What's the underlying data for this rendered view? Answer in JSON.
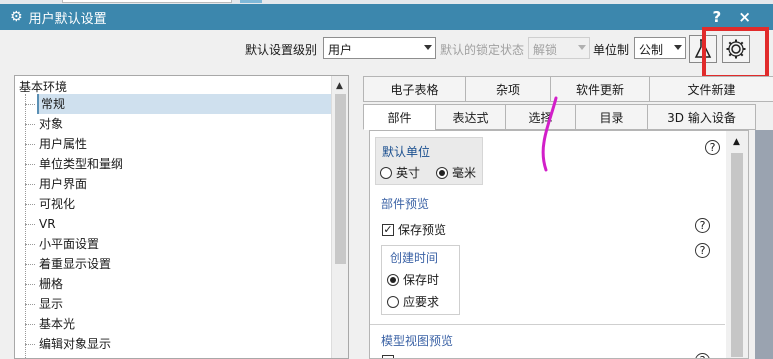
{
  "window": {
    "title": "用户默认设置",
    "controls": "? ×"
  },
  "toolbar": {
    "default_level_label": "默认设置级别",
    "default_level_value": "用户",
    "lock_state_label": "默认的锁定状态",
    "lock_state_value": "解锁",
    "unit_system_label": "单位制",
    "unit_system_value": "公制"
  },
  "tree": {
    "root": "基本环境",
    "items": [
      {
        "label": "常规",
        "selected": true
      },
      {
        "label": "对象"
      },
      {
        "label": "用户属性"
      },
      {
        "label": "单位类型和量纲"
      },
      {
        "label": "用户界面"
      },
      {
        "label": "可视化"
      },
      {
        "label": "VR"
      },
      {
        "label": "小平面设置"
      },
      {
        "label": "着重显示设置"
      },
      {
        "label": "栅格"
      },
      {
        "label": "显示"
      },
      {
        "label": "基本光"
      },
      {
        "label": "编辑对象显示"
      }
    ]
  },
  "tabs": {
    "row1": [
      "电子表格",
      "杂项",
      "软件更新",
      "文件新建"
    ],
    "row2": [
      "部件",
      "表达式",
      "选择",
      "目录",
      "3D 输入设备"
    ],
    "active": "部件"
  },
  "content": {
    "default_unit_title": "默认单位",
    "unit_inch": "英寸",
    "unit_mm": "毫米",
    "selected_unit": "毫米",
    "part_preview_title": "部件预览",
    "save_preview_label": "保存预览",
    "save_preview_checked": true,
    "creation_time_title": "创建时间",
    "on_save_label": "保存时",
    "on_demand_label": "应要求",
    "creation_time_value": "保存时",
    "model_view_preview_title": "模型视图预览",
    "help_mark": "?"
  },
  "colors": {
    "titlebar": "#3c87ad",
    "highlight_box": "#e12b2b",
    "section_title": "#3c63a6",
    "annotation_stroke": "#d21fc9"
  },
  "icons": [
    "gear-icon",
    "help-icon",
    "close-icon",
    "flask-icon",
    "settings-gear-icon",
    "scroll-up-icon"
  ]
}
